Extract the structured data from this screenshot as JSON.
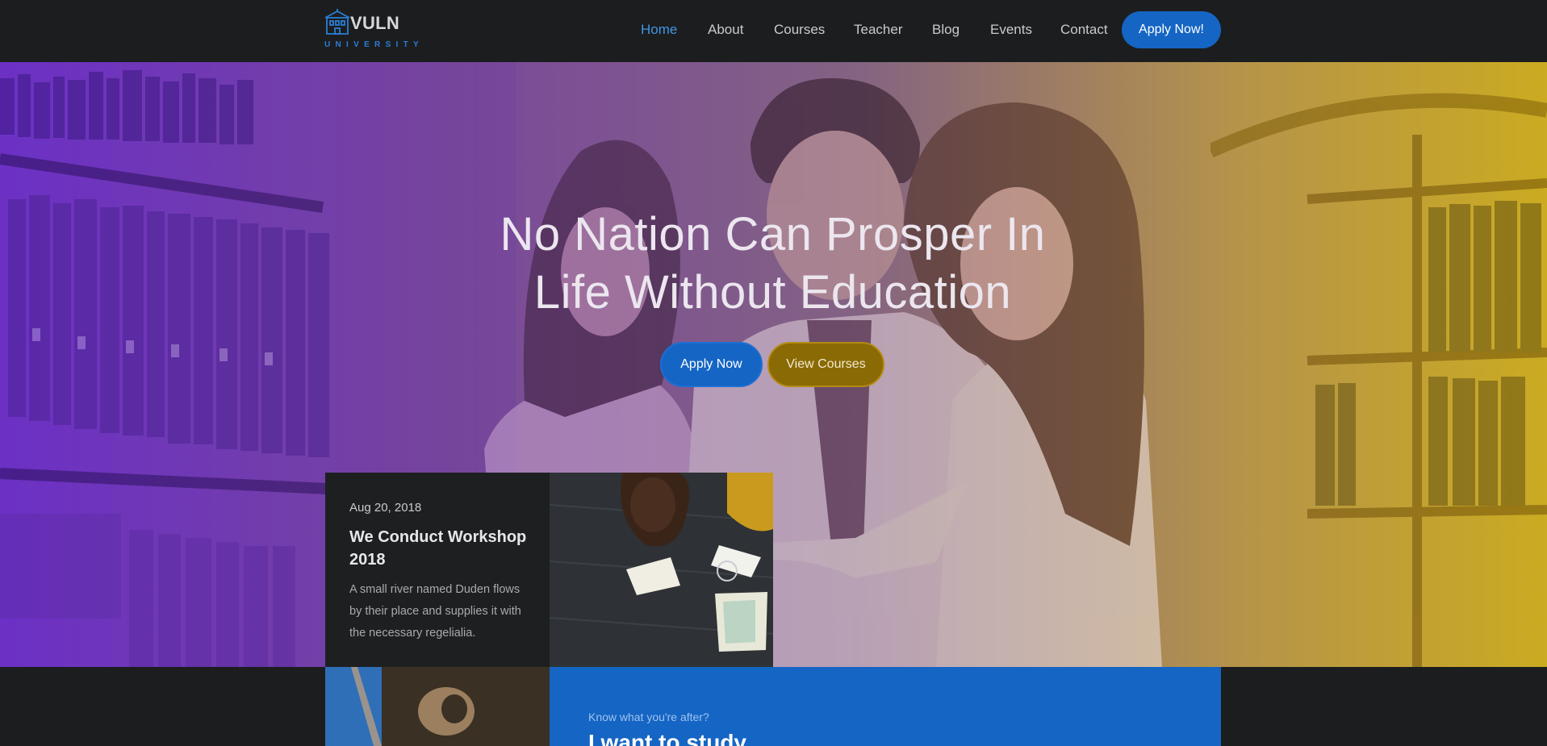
{
  "logo": {
    "name": "VULN",
    "subtitle": "UNIVERSITY",
    "icon": "university-building-icon"
  },
  "nav": {
    "items": [
      {
        "label": "Home",
        "active": true
      },
      {
        "label": "About",
        "active": false
      },
      {
        "label": "Courses",
        "active": false
      },
      {
        "label": "Teacher",
        "active": false
      },
      {
        "label": "Blog",
        "active": false
      },
      {
        "label": "Events",
        "active": false
      },
      {
        "label": "Contact",
        "active": false
      }
    ],
    "cta_label": "Apply Now!"
  },
  "hero": {
    "title_line1": "No Nation Can Prosper In",
    "title_line2": "Life Without Education",
    "primary_button": "Apply Now",
    "secondary_button": "View Courses"
  },
  "event": {
    "date": "Aug 20, 2018",
    "title": "We Conduct Workshop 2018",
    "description": "A small river named Duden flows by their place and supplies it with the necessary regelialia."
  },
  "study": {
    "kicker": "Know what you're after?",
    "title": "I want to study"
  },
  "colors": {
    "nav_background": "#1c1d1f",
    "accent_blue": "#1565c4",
    "active_link": "#3f96e4",
    "gold_button": "#8a6a05",
    "card_background": "#1e1f21"
  }
}
